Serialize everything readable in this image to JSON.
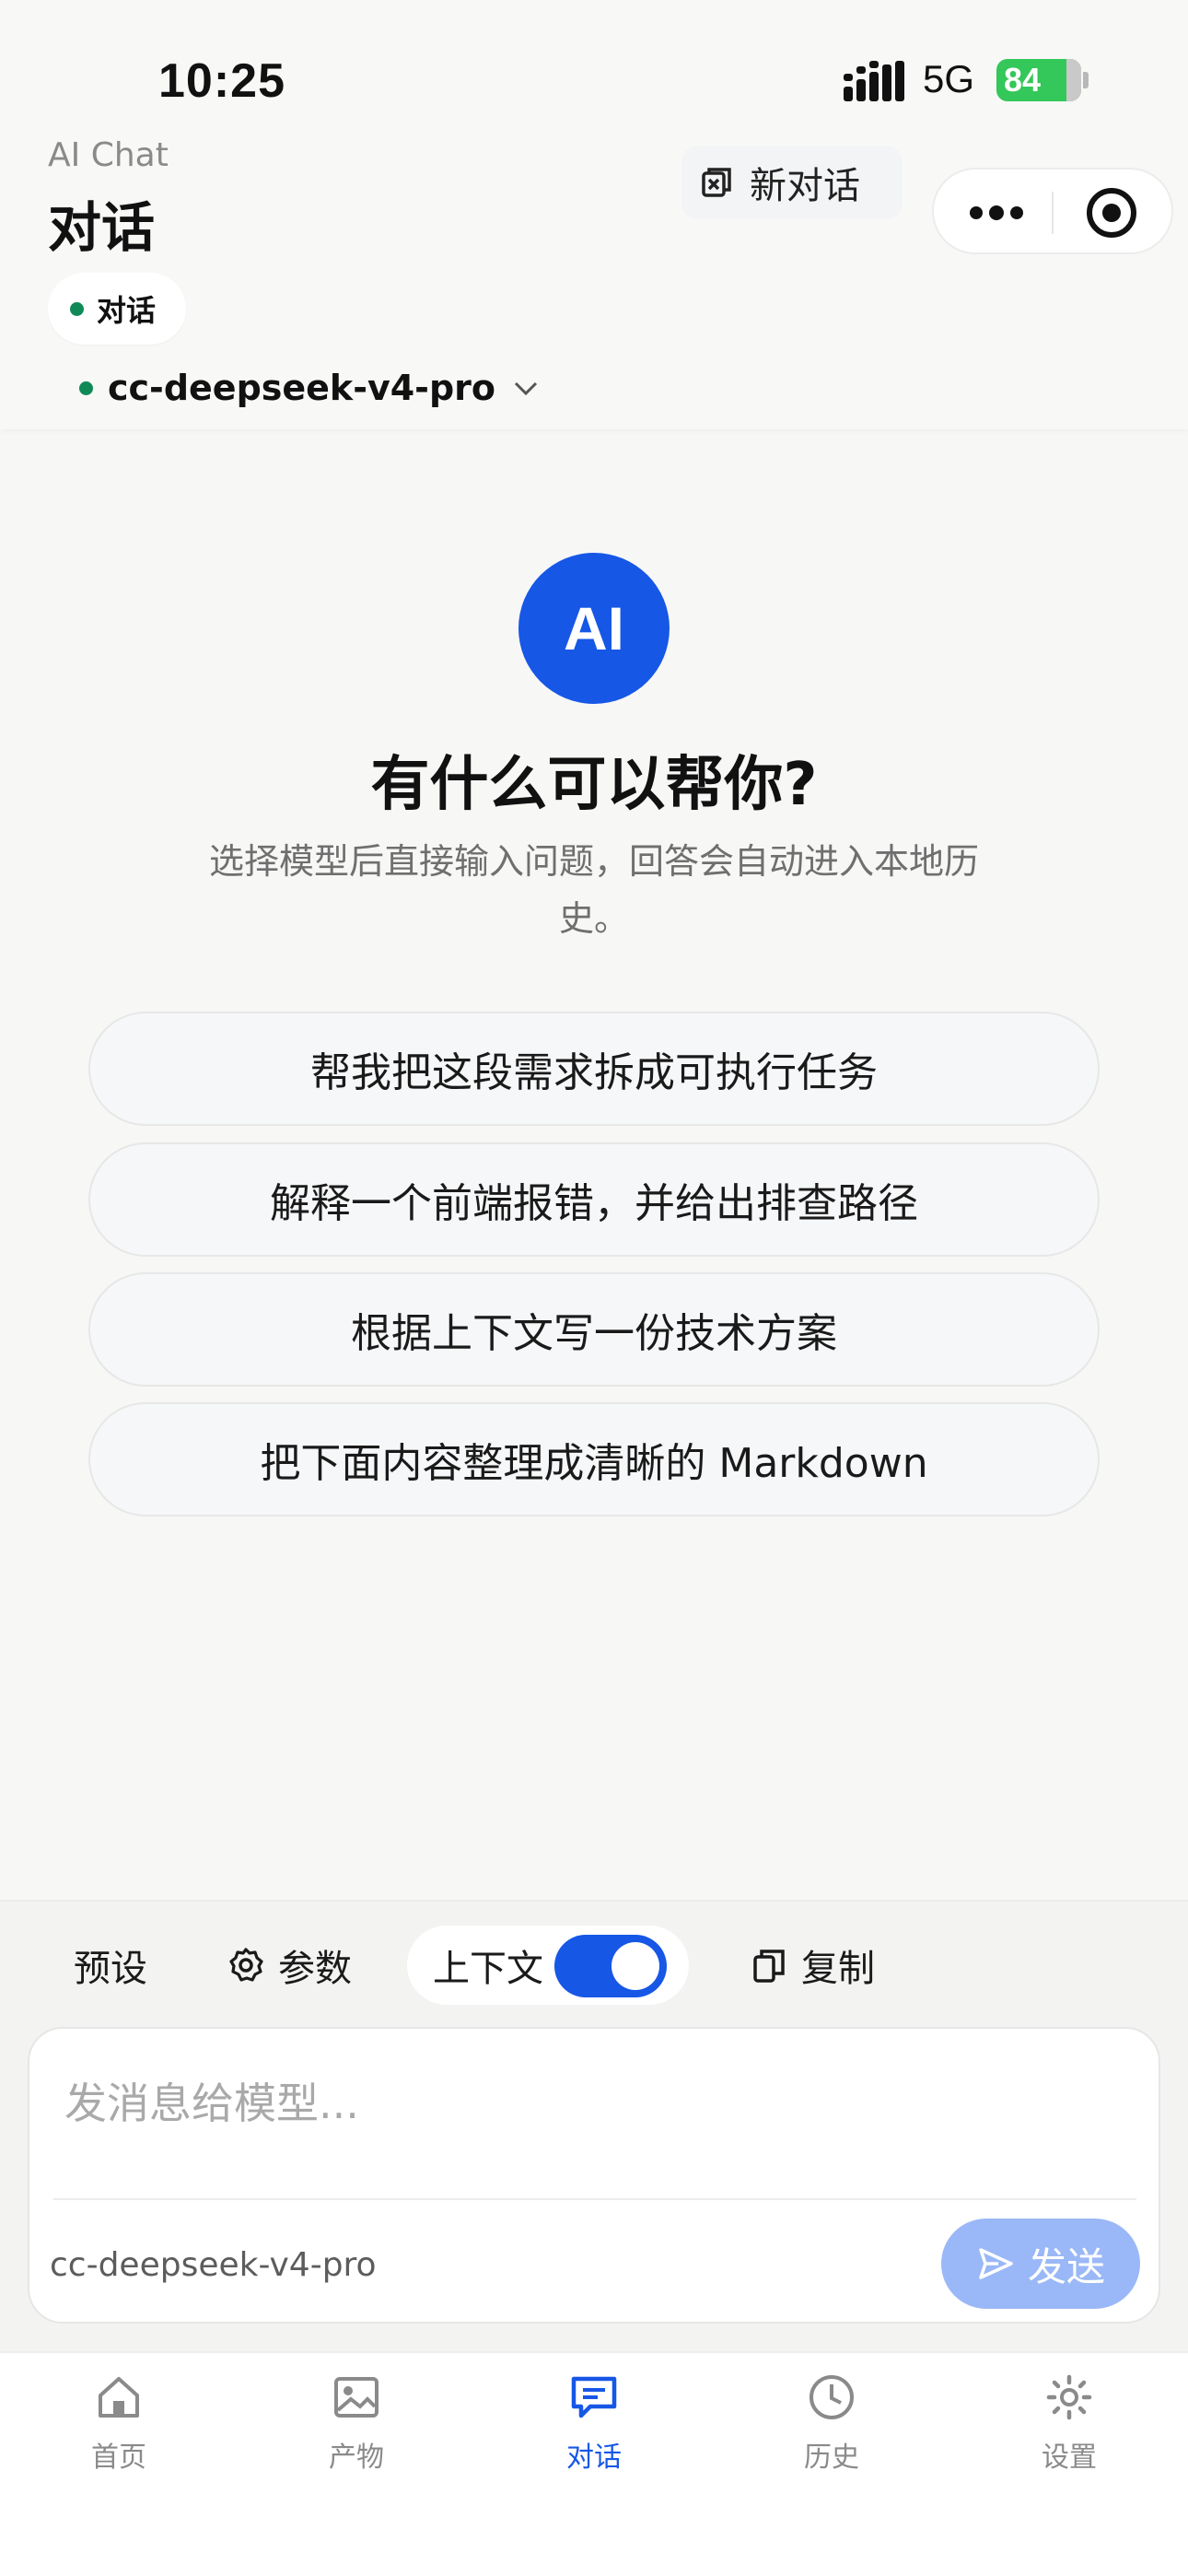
{
  "status_bar": {
    "time": "10:25",
    "network": "5G",
    "battery": "84"
  },
  "header": {
    "app_label": "AI Chat",
    "title": "对话",
    "mode_chip": "对话",
    "new_chat_label": "新对话",
    "model_name": "cc-deepseek-v4-pro"
  },
  "welcome": {
    "avatar_text": "AI",
    "title": "有什么可以帮你?",
    "subtitle": "选择模型后直接输入问题，回答会自动进入本地历史。"
  },
  "suggestions": [
    "帮我把这段需求拆成可执行任务",
    "解释一个前端报错，并给出排查路径",
    "根据上下文写一份技术方案",
    "把下面内容整理成清晰的 Markdown"
  ],
  "toolbar": {
    "preset_label": "预设",
    "params_label": "参数",
    "context_label": "上下文",
    "context_enabled": true,
    "copy_label": "复制"
  },
  "composer": {
    "placeholder": "发消息给模型...",
    "model_name": "cc-deepseek-v4-pro",
    "send_label": "发送"
  },
  "tabs": [
    {
      "label": "首页",
      "icon": "home-icon",
      "active": false
    },
    {
      "label": "产物",
      "icon": "image-icon",
      "active": false
    },
    {
      "label": "对话",
      "icon": "chat-icon",
      "active": true
    },
    {
      "label": "历史",
      "icon": "clock-icon",
      "active": false
    },
    {
      "label": "设置",
      "icon": "gear-icon",
      "active": false
    }
  ],
  "colors": {
    "accent": "#1657e6",
    "status_dot": "#0f8a57",
    "battery": "#34c759"
  }
}
